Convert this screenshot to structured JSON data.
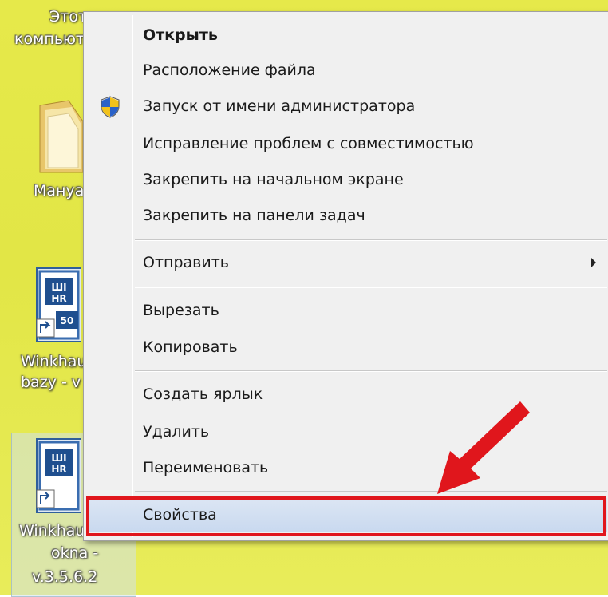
{
  "desktop": {
    "labels": [
      "Этот",
      "компьютер",
      "Мануал",
      "Winkhaus",
      "bazy - v",
      "Winkhaus",
      "okna -",
      "v.3.5.6.2"
    ],
    "icon_text_1": "ШI\nHR\n50",
    "icon_text_2": "ШI\nHR"
  },
  "menu": {
    "open": "Открыть",
    "file_location": "Расположение файла",
    "run_as_admin": "Запуск от имени администратора",
    "troubleshoot_compat": "Исправление проблем с совместимостью",
    "pin_start": "Закрепить на начальном экране",
    "pin_taskbar": "Закрепить на панели задач",
    "send_to": "Отправить",
    "cut": "Вырезать",
    "copy": "Копировать",
    "create_shortcut": "Создать ярлык",
    "delete": "Удалить",
    "rename": "Переименовать",
    "properties": "Свойства"
  },
  "colors": {
    "highlight": "#e0161c",
    "wallpaper": "#e4e848",
    "menu_bg": "#f0f0f0",
    "hover_bg": "#c9d9ef"
  },
  "icons": {
    "shield": "uac-shield-icon",
    "submenu": "chevron-right-icon",
    "folder": "folder-icon",
    "app": "app-shortcut-icon",
    "pointer": "red-arrow-icon"
  }
}
